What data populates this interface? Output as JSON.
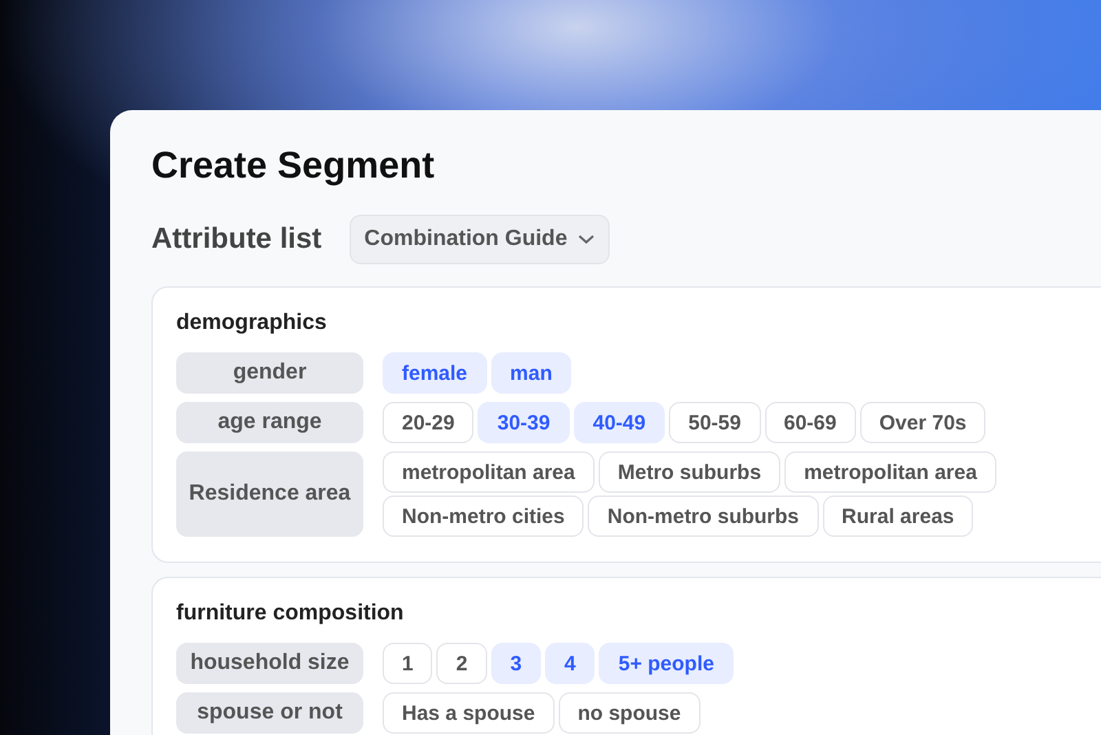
{
  "title": "Create Segment",
  "attribute_list": {
    "label": "Attribute list",
    "dropdown": "Combination Guide"
  },
  "sections": [
    {
      "title": "demographics",
      "attributes": [
        {
          "label": "gender",
          "options": [
            {
              "label": "female",
              "selected": true
            },
            {
              "label": "man",
              "selected": true
            }
          ]
        },
        {
          "label": "age range",
          "options": [
            {
              "label": "20-29",
              "selected": false
            },
            {
              "label": "30-39",
              "selected": true
            },
            {
              "label": "40-49",
              "selected": true
            },
            {
              "label": "50-59",
              "selected": false
            },
            {
              "label": "60-69",
              "selected": false
            },
            {
              "label": "Over 70s",
              "selected": false
            }
          ]
        },
        {
          "label": "Residence area",
          "options": [
            {
              "label": "metropolitan area",
              "selected": false
            },
            {
              "label": "Metro suburbs",
              "selected": false
            },
            {
              "label": "metropolitan area",
              "selected": false
            },
            {
              "label": "Non-metro cities",
              "selected": false
            },
            {
              "label": "Non-metro suburbs",
              "selected": false
            },
            {
              "label": "Rural areas",
              "selected": false
            }
          ]
        }
      ]
    },
    {
      "title": "furniture composition",
      "attributes": [
        {
          "label": "household size",
          "options": [
            {
              "label": "1",
              "selected": false
            },
            {
              "label": "2",
              "selected": false
            },
            {
              "label": "3",
              "selected": true
            },
            {
              "label": "4",
              "selected": true
            },
            {
              "label": "5+ people",
              "selected": true
            }
          ]
        },
        {
          "label": "spouse or not",
          "options": [
            {
              "label": "Has a spouse",
              "selected": false
            },
            {
              "label": "no spouse",
              "selected": false
            }
          ]
        }
      ]
    }
  ]
}
